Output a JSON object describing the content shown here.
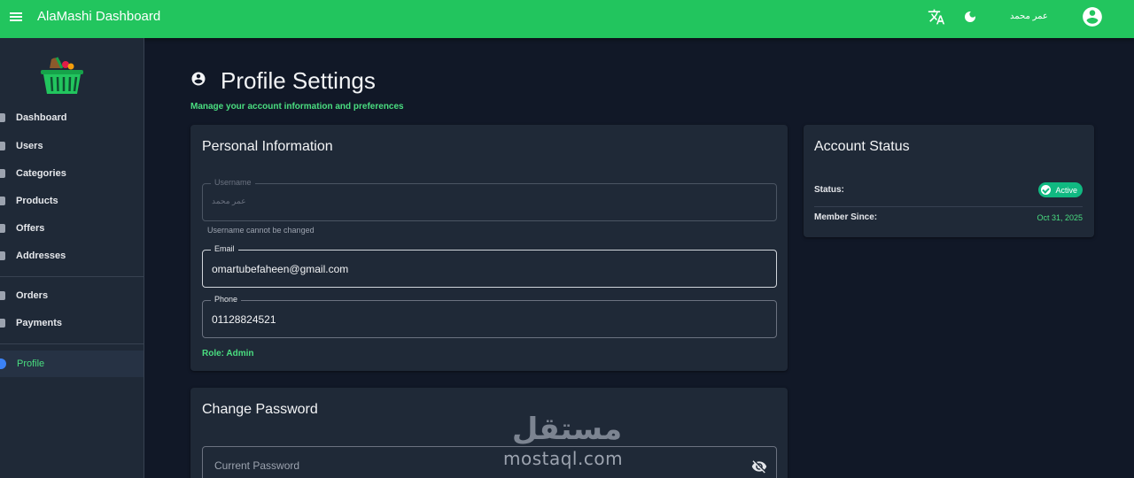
{
  "header": {
    "title": "AlaMashi Dashboard",
    "user_name": "عمر محمد",
    "bg_color": "#22c55e"
  },
  "sidebar": {
    "items": [
      {
        "label": "Dashboard",
        "icon": "dashboard-icon"
      },
      {
        "label": "Users",
        "icon": "users-icon"
      },
      {
        "label": "Categories",
        "icon": "categories-icon"
      },
      {
        "label": "Products",
        "icon": "products-icon"
      },
      {
        "label": "Offers",
        "icon": "offers-icon"
      },
      {
        "label": "Addresses",
        "icon": "location-icon"
      },
      {
        "label": "Orders",
        "icon": "cart-icon"
      },
      {
        "label": "Payments",
        "icon": "payment-icon"
      },
      {
        "label": "Profile",
        "icon": "profile-icon",
        "active": true
      }
    ]
  },
  "page": {
    "title": "Profile Settings",
    "subtitle": "Manage your account information and preferences"
  },
  "personal": {
    "title": "Personal Information",
    "username_label": "Username",
    "username_value": "عمر محمد",
    "username_helper": "Username cannot be changed",
    "email_label": "Email",
    "email_value": "omartubefaheen@gmail.com",
    "phone_label": "Phone",
    "phone_value": "01128824521",
    "role": "Role: Admin"
  },
  "account_status": {
    "title": "Account Status",
    "status_label": "Status:",
    "status_value": "Active",
    "member_label": "Member Since:",
    "member_value": "Oct 31, 2025"
  },
  "password": {
    "title": "Change Password",
    "current_placeholder": "Current Password"
  },
  "watermark": {
    "arabic": "مستقل",
    "latin": "mostaql.com"
  },
  "colors": {
    "accent_green": "#4ade80",
    "active_badge": "#10b981",
    "background": "#111827",
    "card": "#1f2937"
  }
}
